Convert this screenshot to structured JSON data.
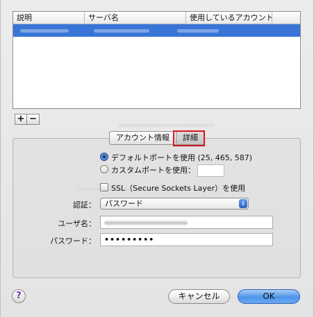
{
  "table": {
    "columns": [
      "説明",
      "サーバ名",
      "使用しているアカウント",
      ""
    ]
  },
  "controls": {
    "add_label": "+",
    "remove_label": "−"
  },
  "tabs": {
    "account_info": "アカウント情報",
    "advanced": "詳細"
  },
  "ports": {
    "default_label": "デフォルトポートを使用 (25, 465, 587)",
    "custom_label": "カスタムポートを使用：",
    "selected": "default"
  },
  "ssl": {
    "label": "SSL（Secure Sockets Layer）を使用",
    "checked": false
  },
  "auth": {
    "label": "認証：",
    "value": "パスワード"
  },
  "username": {
    "label": "ユーザ名："
  },
  "password": {
    "label": "パスワード：",
    "value": "•••••••••"
  },
  "buttons": {
    "help": "?",
    "cancel": "キャンセル",
    "ok": "OK"
  },
  "colors": {
    "selection": "#3875d7",
    "highlight_box": "#d9141c",
    "default_button": "#4f94ea"
  }
}
